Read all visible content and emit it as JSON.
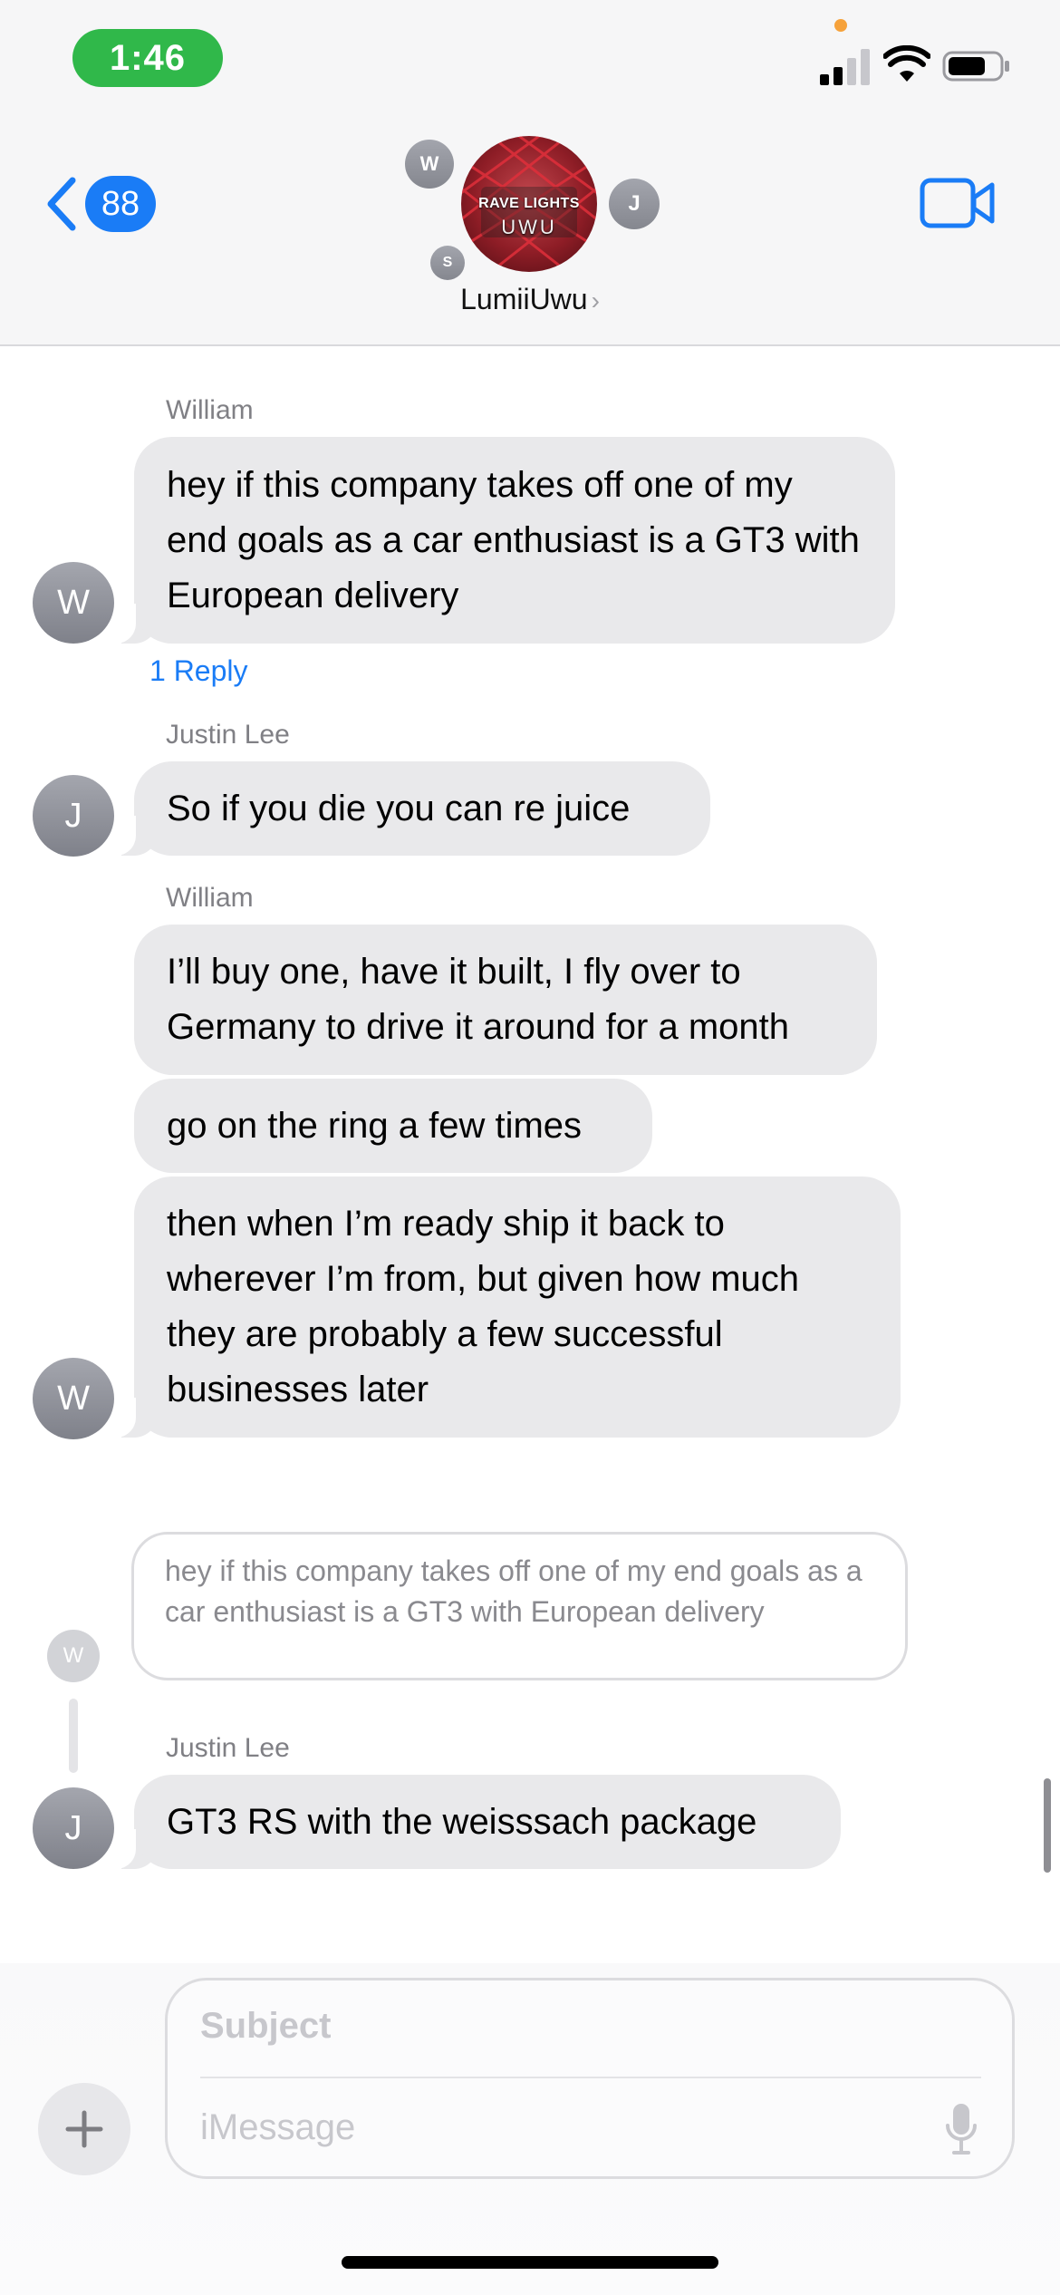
{
  "status_bar": {
    "time": "1:46"
  },
  "header": {
    "back_count": "88",
    "group_name": "LumiiUwu",
    "avatar_text_line1": "RAVE LIGHTS",
    "avatar_text_line2": "UWU",
    "mini_avatars": [
      "W",
      "J",
      "S"
    ]
  },
  "messages": [
    {
      "sender": "William",
      "text": "hey if this company takes off one of my end goals as a car enthusiast is a GT3 with European delivery",
      "avatar": "W",
      "reply_label": "1 Reply"
    },
    {
      "sender": "Justin Lee",
      "text": "So if you die you can re juice",
      "avatar": "J"
    },
    {
      "sender": "William",
      "text": "I’ll buy one, have it built, I fly over to Germany to drive it around for a month"
    },
    {
      "text": "go on the ring a few times"
    },
    {
      "text": "then when I’m ready ship it back to wherever I’m from, but given how much they are probably a few successful businesses later",
      "avatar": "W"
    }
  ],
  "thread": {
    "quoted_text": "hey if this company takes off one of my end goals as a car enthusiast is a GT3 with European delivery",
    "quoted_avatar": "W",
    "reply": {
      "sender": "Justin Lee",
      "text": "GT3 RS with the weisssach package",
      "avatar": "J"
    }
  },
  "composer": {
    "subject_placeholder": "Subject",
    "message_placeholder": "iMessage"
  },
  "colors": {
    "accent": "#1a7cf6",
    "bubble": "#e9e9eb",
    "time_pill": "#30b84a"
  }
}
